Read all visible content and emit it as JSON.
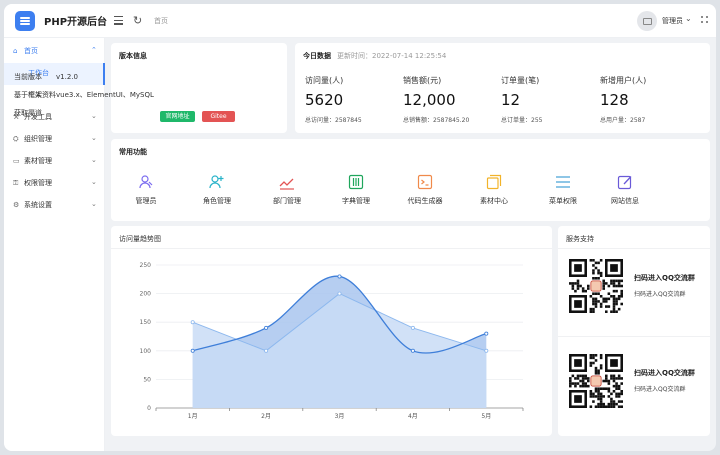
{
  "app": {
    "title": "PHP开源后台"
  },
  "topbar": {
    "breadcrumb": "首页",
    "user_name": "管理员",
    "icons": [
      "menu-fold-icon",
      "refresh-icon",
      "avatar-icon",
      "chevron-down-icon",
      "more-icon"
    ]
  },
  "sidebar": {
    "items": [
      {
        "label": "首页",
        "icon": "home-icon",
        "open": true
      },
      {
        "label": "工作台",
        "active": true
      },
      {
        "label": "个人资料"
      },
      {
        "label": "开发工具",
        "icon": "tool-icon"
      },
      {
        "label": "组织管理",
        "icon": "org-icon"
      },
      {
        "label": "素材管理",
        "icon": "media-icon"
      },
      {
        "label": "权限管理",
        "icon": "lock-icon"
      },
      {
        "label": "系统设置",
        "icon": "gear-icon"
      }
    ]
  },
  "version": {
    "title": "版本信息",
    "rows": [
      {
        "key": "当前版本",
        "value": "v1.2.0"
      },
      {
        "key": "基于框架",
        "value": "vue3.x、ElementUI、MySQL"
      },
      {
        "key": "获取渠道",
        "value": ""
      }
    ],
    "buttons": [
      {
        "label": "官网地址",
        "color": "#1fb86a"
      },
      {
        "label": "Gitee",
        "color": "#e35454"
      }
    ]
  },
  "today": {
    "title": "今日数据",
    "update_time": "更新时间：2022-07-14 12:25:54",
    "stats": [
      {
        "label": "访问量(人)",
        "value": "5620",
        "total": "总访问量：2587845"
      },
      {
        "label": "销售额(元)",
        "value": "12,000",
        "total": "总销售额：2587845.20"
      },
      {
        "label": "订单量(笔)",
        "value": "12",
        "total": "总订单量：255"
      },
      {
        "label": "新增用户(人)",
        "value": "128",
        "total": "总用户量：2587"
      }
    ]
  },
  "functions": {
    "title": "常用功能",
    "items": [
      {
        "label": "管理员",
        "icon": "admin-icon",
        "color": "#7b6cf0"
      },
      {
        "label": "角色管理",
        "icon": "role-icon",
        "color": "#29b3c9"
      },
      {
        "label": "部门管理",
        "icon": "department-icon",
        "color": "#e35454"
      },
      {
        "label": "字典管理",
        "icon": "dictionary-icon",
        "color": "#1fa65c"
      },
      {
        "label": "代码生成器",
        "icon": "code-icon",
        "color": "#f08a4b"
      },
      {
        "label": "素材中心",
        "icon": "material-icon",
        "color": "#f2b32a"
      },
      {
        "label": "菜单权限",
        "icon": "menu-icon",
        "color": "#4aa3d8"
      },
      {
        "label": "网站信息",
        "icon": "edit-icon",
        "color": "#6a5ad8"
      }
    ]
  },
  "chart_data": {
    "type": "area",
    "title": "访问量趋势图",
    "categories": [
      "1月",
      "2月",
      "3月",
      "4月",
      "5月"
    ],
    "series": [
      {
        "values": [
          100,
          140,
          230,
          100,
          130
        ],
        "color": "#3f7fd9"
      },
      {
        "values": [
          150,
          100,
          200,
          140,
          100
        ],
        "color": "#8db8ee"
      }
    ],
    "ylim": [
      0,
      250
    ],
    "yticks": [
      0,
      50,
      100,
      150,
      200,
      250
    ],
    "grid": true
  },
  "support": {
    "title": "服务支持",
    "items": [
      {
        "title": "扫码进入QQ交流群",
        "sub": "扫码进入QQ交流群"
      },
      {
        "title": "扫码进入QQ交流群",
        "sub": "扫码进入QQ交流群"
      }
    ]
  }
}
